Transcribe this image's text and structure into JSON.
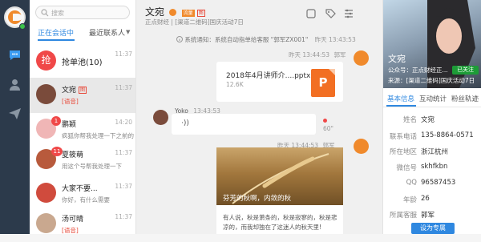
{
  "sidebar": {
    "items": [
      {
        "icon": "chat-icon"
      },
      {
        "icon": "contact-icon"
      },
      {
        "icon": "send-icon"
      }
    ]
  },
  "conversations": {
    "search_placeholder": "搜索",
    "tabs": [
      "正在会话中",
      "最近联系人"
    ],
    "pool": {
      "label": "抢单池(10)",
      "avatar_text": "抢",
      "time": "11:37"
    },
    "items": [
      {
        "name": "文宛",
        "tag": "图",
        "preview": "[语音]",
        "time": "11:37",
        "avatar_color": "#7a4b3b",
        "badge": ""
      },
      {
        "name": "鹏颖",
        "tag": "",
        "preview": "疯狐你帮我处理一下之前的",
        "time": "14:20",
        "avatar_color": "#f0b6b6",
        "badge": "1"
      },
      {
        "name": "夏筱萌",
        "tag": "",
        "preview": "用这个号帮我处理一下",
        "time": "11:37",
        "avatar_color": "#b85a3c",
        "badge": "11"
      },
      {
        "name": "大家不要...",
        "tag": "",
        "preview": "你好，有什么需要",
        "time": "11:37",
        "avatar_color": "#d04b3d",
        "badge": ""
      },
      {
        "name": "汤可晴",
        "tag": "",
        "preview": "[语音]",
        "time": "11:37",
        "avatar_color": "#c9a88f",
        "badge": ""
      }
    ]
  },
  "chat": {
    "title": "文宛",
    "tags": [
      "流量",
      "图"
    ],
    "subtitle": "正点财经 | [渠道二维码]国庆活动7日",
    "toolbar_icons": [
      "window-icon",
      "tag-icon",
      "settings-icon"
    ],
    "system_note": "系统通知：系统自动指单给客服 \"郭军ZX001\"",
    "system_time": "昨天 13:43:53",
    "file_msg": {
      "meta": "昨天 13:44:53",
      "sender": "郭军",
      "name": "2018年4月讲师介....pptx",
      "size": "12.6K",
      "icon_text": "P"
    },
    "voice_msg": {
      "sender": "Yoko",
      "time": "13:43:53",
      "duration": "60\""
    },
    "article_msg": {
      "meta": "昨天 13:44:53",
      "sender": "郭军",
      "title": "芬芳的秋啊，内敛的秋",
      "body": "有人说，秋是萧条的，秋是寂寥的，秋是悲凉的，而我却独在了这迷人的秋天里!"
    }
  },
  "profile": {
    "name": "文宛",
    "gz": "公众号：正点财经正...",
    "source": "来源：[渠道二维码]国庆活动7日",
    "follow": "已关注",
    "tabs": [
      "基本信息",
      "互动统计",
      "粉丝轨迹"
    ],
    "fields": [
      {
        "label": "姓名",
        "value": "文宛"
      },
      {
        "label": "联系电话",
        "value": "135-8864-0571"
      },
      {
        "label": "所在地区",
        "value": "浙江杭州"
      },
      {
        "label": "微信号",
        "value": "skhfkbn"
      },
      {
        "label": "QQ",
        "value": "96587453"
      },
      {
        "label": "年龄",
        "value": "26"
      },
      {
        "label": "所属客服",
        "value": "郭军"
      }
    ],
    "action": "设为专属"
  },
  "colors": {
    "accent": "#2f88e0",
    "sidebar_bg": "#2c3a4b",
    "ppt": "#f26f23",
    "follow": "#1d9c37"
  }
}
